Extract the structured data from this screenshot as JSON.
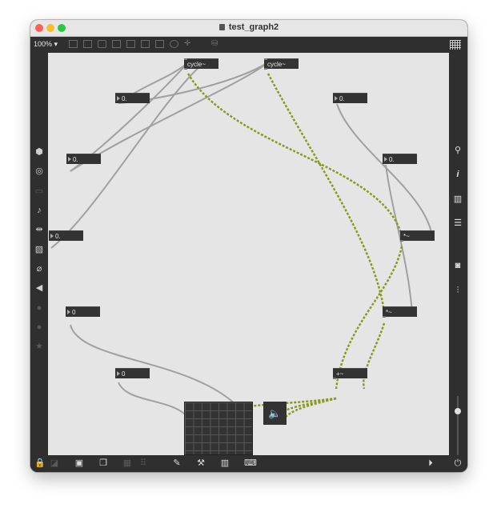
{
  "window": {
    "title": "test_graph2"
  },
  "toolbar": {
    "zoom": "100% ▾"
  },
  "objects": {
    "cycle1": "cycle~",
    "cycle2": "cycle~",
    "num1": "0.",
    "num2": "0.",
    "num3": "0.",
    "num4": "0.",
    "num5": "0.",
    "num6": "0",
    "num7": "0",
    "mul1": "*~",
    "mul2": "*~",
    "plus": "+~"
  },
  "left_sidebar": {
    "icons": [
      "cube-icon",
      "target-icon",
      "film-icon",
      "music-note-icon",
      "split-arrows-icon",
      "image-icon",
      "paperclip-icon",
      "plug-icon",
      "p-circle-icon",
      "b-circle-icon",
      "star-icon"
    ]
  },
  "right_sidebar": {
    "icons": [
      "search-icon",
      "info-icon",
      "columns-icon",
      "list-icon",
      "camera-icon",
      "mixer-icon"
    ]
  },
  "bottom_bar": {
    "icons": [
      "lock-icon",
      "edit-icon",
      "presentation-icon",
      "windows-icon",
      "grid-icon",
      "tools-icon",
      "wrench-icon",
      "piano-icon",
      "keyboard-icon",
      "play-icon",
      "power-icon"
    ]
  },
  "colors": {
    "signal_cord": "#8a9a1e",
    "control_cord": "#a0a0a0",
    "canvas": "#e5e5e5"
  },
  "volume_slider": {
    "level": 0.77
  }
}
